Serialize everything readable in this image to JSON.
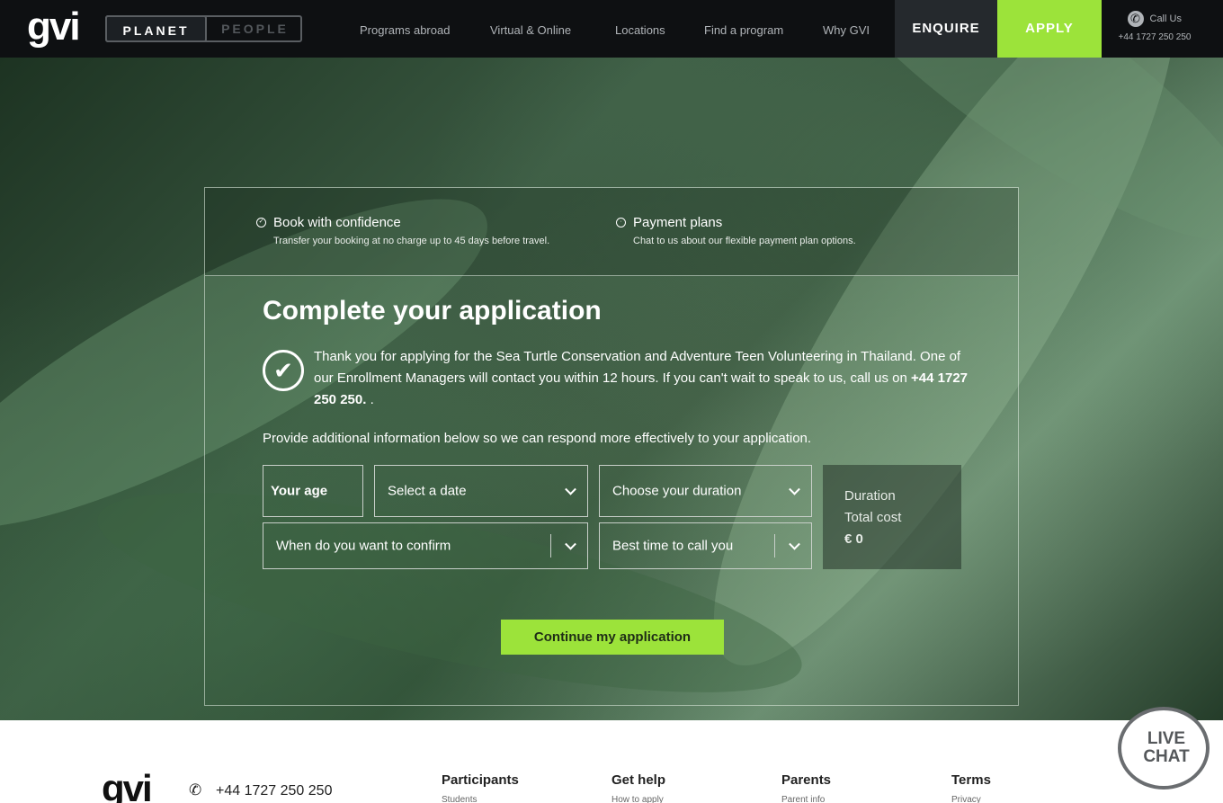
{
  "nav": {
    "logo": "gvi",
    "toggle": {
      "planet": "PLANET",
      "people": "PEOPLE"
    },
    "links": [
      "Programs abroad",
      "Virtual & Online",
      "Locations",
      "Find a program",
      "Why GVI"
    ],
    "enquire": "ENQUIRE",
    "apply": "APPLY",
    "call_label": "Call Us",
    "call_number": "+44 1727 250 250",
    "colors": {
      "apply_bg": "#9ce33a",
      "enquire_bg": "#25292d",
      "nav_bg": "#0e1012"
    }
  },
  "perks": [
    {
      "title": "Book with confidence",
      "subtitle": "Transfer your booking at no charge up to 45 days before travel.",
      "icon": "shield-check-icon"
    },
    {
      "title": "Payment plans",
      "subtitle": "Chat to us about our flexible payment plan options.",
      "icon": "clock-icon"
    }
  ],
  "form": {
    "title": "Complete your application",
    "thanks_text": "Thank you for applying for the Sea Turtle Conservation and Adventure Teen Volunteering in Thailand. One of our Enrollment Managers will contact you within 12 hours. If you can't wait to speak to us, call us on",
    "thanks_phone": "+44 1727 250 250.",
    "thanks_tail": ".",
    "provide_text": "Provide additional information below so we can respond more effectively to your application.",
    "age_placeholder": "Your age",
    "date_select": "Select a date",
    "duration_select": "Choose your duration",
    "confirm_select": "When do you want to confirm",
    "call_time_select": "Best time to call you",
    "summary": {
      "duration_label": "Duration",
      "total_label": "Total cost",
      "total_value": "€ 0"
    },
    "continue_label": "Continue my application"
  },
  "footer": {
    "logo": "gvi",
    "phone": "+44 1727 250 250",
    "columns": [
      {
        "heading": "Participants",
        "first_link": "Students"
      },
      {
        "heading": "Get help",
        "first_link": "How to apply"
      },
      {
        "heading": "Parents",
        "first_link": "Parent info"
      },
      {
        "heading": "Terms",
        "first_link": "Privacy"
      }
    ]
  },
  "livechat": {
    "label_line1": "LIVE",
    "label_line2": "CHAT"
  }
}
